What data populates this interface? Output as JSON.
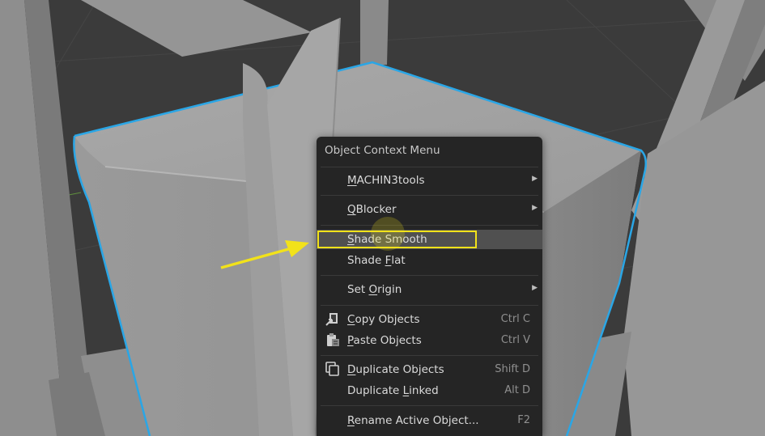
{
  "context_menu": {
    "title": "Object Context Menu",
    "items": [
      {
        "pre": "",
        "u": "M",
        "post": "ACHIN3tools",
        "shortcut": "",
        "submenu": true,
        "icon": ""
      },
      {
        "pre": "",
        "u": "Q",
        "post": "Blocker",
        "shortcut": "",
        "submenu": true,
        "icon": ""
      },
      {
        "pre": "",
        "u": "S",
        "post": "hade Smooth",
        "shortcut": "",
        "submenu": false,
        "icon": "",
        "highlighted": true
      },
      {
        "pre": "Shade ",
        "u": "F",
        "post": "lat",
        "shortcut": "",
        "submenu": false,
        "icon": ""
      },
      {
        "pre": "Set ",
        "u": "O",
        "post": "rigin",
        "shortcut": "",
        "submenu": true,
        "icon": ""
      },
      {
        "pre": "",
        "u": "C",
        "post": "opy Objects",
        "shortcut": "Ctrl C",
        "submenu": false,
        "icon": "copy-icon"
      },
      {
        "pre": "",
        "u": "P",
        "post": "aste Objects",
        "shortcut": "Ctrl V",
        "submenu": false,
        "icon": "paste-icon"
      },
      {
        "pre": "",
        "u": "D",
        "post": "uplicate Objects",
        "shortcut": "Shift D",
        "submenu": false,
        "icon": "duplicate-icon"
      },
      {
        "pre": "Duplicate ",
        "u": "L",
        "post": "inked",
        "shortcut": "Alt D",
        "submenu": false,
        "icon": ""
      },
      {
        "pre": "",
        "u": "R",
        "post": "ename Active Object...",
        "shortcut": "F2",
        "submenu": false,
        "icon": ""
      }
    ]
  },
  "annotation": {
    "color": "#f2e21a",
    "highlighted_item": "Shade Smooth"
  },
  "colors": {
    "menu_bg": "#252525",
    "highlight_bg": "#505050",
    "selection_outline": "#2aa6e6",
    "viewport_bg": "#3b3b3b"
  }
}
